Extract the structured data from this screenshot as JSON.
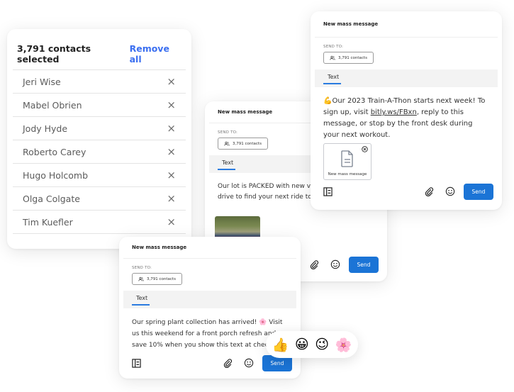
{
  "contacts_panel": {
    "title": "3,791 contacts selected",
    "remove_all_label": "Remove all",
    "contacts": [
      "Jeri Wise",
      "Mabel Obrien",
      "Jody Hyde",
      "Roberto Carey",
      "Hugo Holcomb",
      "Olga Colgate",
      "Tim Kuefler"
    ],
    "remove_icon": "×"
  },
  "message_cards": {
    "car": {
      "title": "New mass message",
      "send_to_label": "SEND TO:",
      "recipients": "3,791 contacts",
      "tab": "Text",
      "body_line1": "Our lot is PACKED with new vehicles! Test",
      "body_line2": "drive to find your next ride today.",
      "send_label": "Send"
    },
    "gym": {
      "title": "New mass message",
      "send_to_label": "SEND TO:",
      "recipients": "3,791 contacts",
      "tab": "Text",
      "emoji": "💪",
      "body_before_link": "Our 2023 Train-A-Thon starts next week! To sign up, visit ",
      "link": "bitly.ws/FBxn",
      "body_after_link": ", reply to this message, or stop by the front desk during your next workout.",
      "attachment_name": "New mass message",
      "send_label": "Send"
    },
    "plant": {
      "title": "New mass message",
      "send_to_label": "SEND TO:",
      "recipients": "3,791 contacts",
      "tab": "Text",
      "body_before_emoji": "Our spring plant collection has arrived! ",
      "emoji": "🌸",
      "body_after_emoji": " Visit us this weekend for a front porch refresh and save 10% when you show this text at checkout.",
      "send_label": "Send"
    }
  },
  "reactions": [
    "👍",
    "😀",
    "😉",
    "🌸"
  ],
  "colors": {
    "accent": "#1b74d6",
    "link_blue": "#3b6ff0"
  }
}
